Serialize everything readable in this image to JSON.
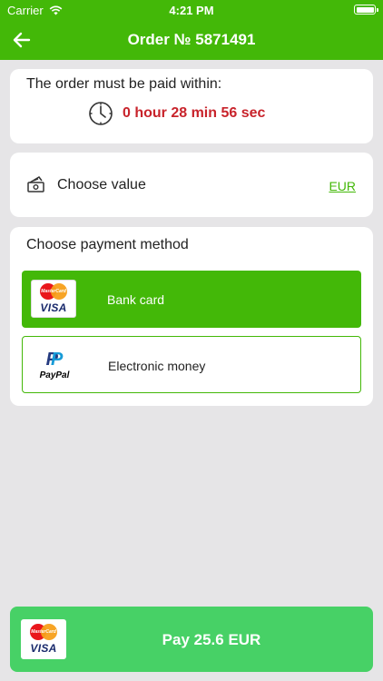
{
  "status_bar": {
    "carrier": "Carrier",
    "time": "4:21 PM"
  },
  "nav": {
    "title": "Order № 5871491",
    "back_icon": "arrow-left-icon"
  },
  "timer_card": {
    "title": "The order must be paid within:",
    "remaining": "0 hour 28 min 56 sec",
    "icon": "clock-icon"
  },
  "value_card": {
    "label": "Choose value",
    "currency": "EUR",
    "icon": "cash-icon"
  },
  "methods_card": {
    "title": "Choose payment method",
    "methods": [
      {
        "label": "Bank card",
        "logo_small": "MasterCard",
        "logo_text": "VISA",
        "selected": true
      },
      {
        "label": "Electronic money",
        "logo_text": "PayPal",
        "selected": false
      }
    ]
  },
  "pay_button": {
    "label": "Pay 25.6 EUR",
    "logo_small": "MasterCard",
    "logo_text": "VISA"
  },
  "colors": {
    "brand_green": "#43b808",
    "pay_green": "#47d166",
    "timer_red": "#c8232b",
    "background": "#e6e5e7"
  }
}
